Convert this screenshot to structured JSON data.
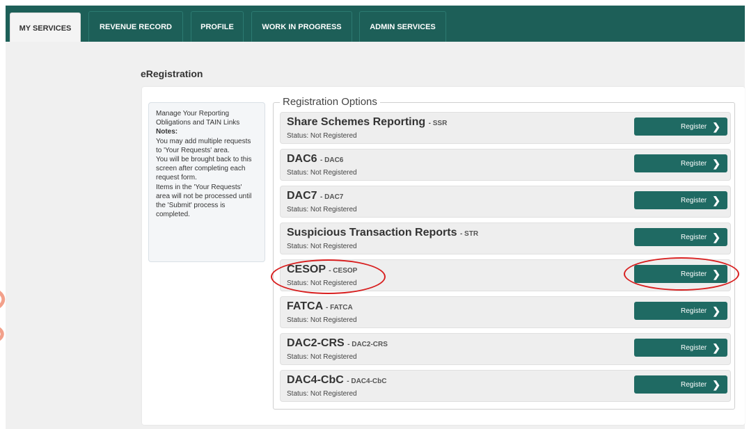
{
  "tabs": [
    {
      "label": "MY SERVICES",
      "active": true
    },
    {
      "label": "REVENUE RECORD",
      "active": false
    },
    {
      "label": "PROFILE",
      "active": false
    },
    {
      "label": "WORK IN PROGRESS",
      "active": false
    },
    {
      "label": "ADMIN SERVICES",
      "active": false
    }
  ],
  "page_title": "eRegistration",
  "notes": {
    "intro": "Manage Your Reporting Obligations and TAIN Links",
    "heading": "Notes:",
    "lines": [
      "You may add multiple requests to 'Your Requests' area.",
      "You will be brought back to this screen after completing each request form.",
      "Items in the 'Your Requests' area will not be processed until the 'Submit' process is completed."
    ]
  },
  "registration": {
    "legend": "Registration Options",
    "register_label": "Register",
    "options": [
      {
        "name": "Share Schemes Reporting",
        "code": "- SSR",
        "status": "Status: Not Registered"
      },
      {
        "name": "DAC6",
        "code": "- DAC6",
        "status": "Status: Not Registered"
      },
      {
        "name": "DAC7",
        "code": "- DAC7",
        "status": "Status: Not Registered"
      },
      {
        "name": "Suspicious Transaction Reports",
        "code": "- STR",
        "status": "Status: Not Registered"
      },
      {
        "name": "CESOP",
        "code": "- CESOP",
        "status": "Status: Not Registered"
      },
      {
        "name": "FATCA",
        "code": "- FATCA",
        "status": "Status: Not Registered"
      },
      {
        "name": "DAC2-CRS",
        "code": "- DAC2-CRS",
        "status": "Status: Not Registered"
      },
      {
        "name": "DAC4-CbC",
        "code": "- DAC4-CbC",
        "status": "Status: Not Registered"
      }
    ]
  },
  "colors": {
    "brand": "#1d5f58",
    "button": "#1f6a63",
    "highlight": "#d81f1f"
  },
  "icons": {
    "register_chevron": "chevron-right-icon"
  }
}
